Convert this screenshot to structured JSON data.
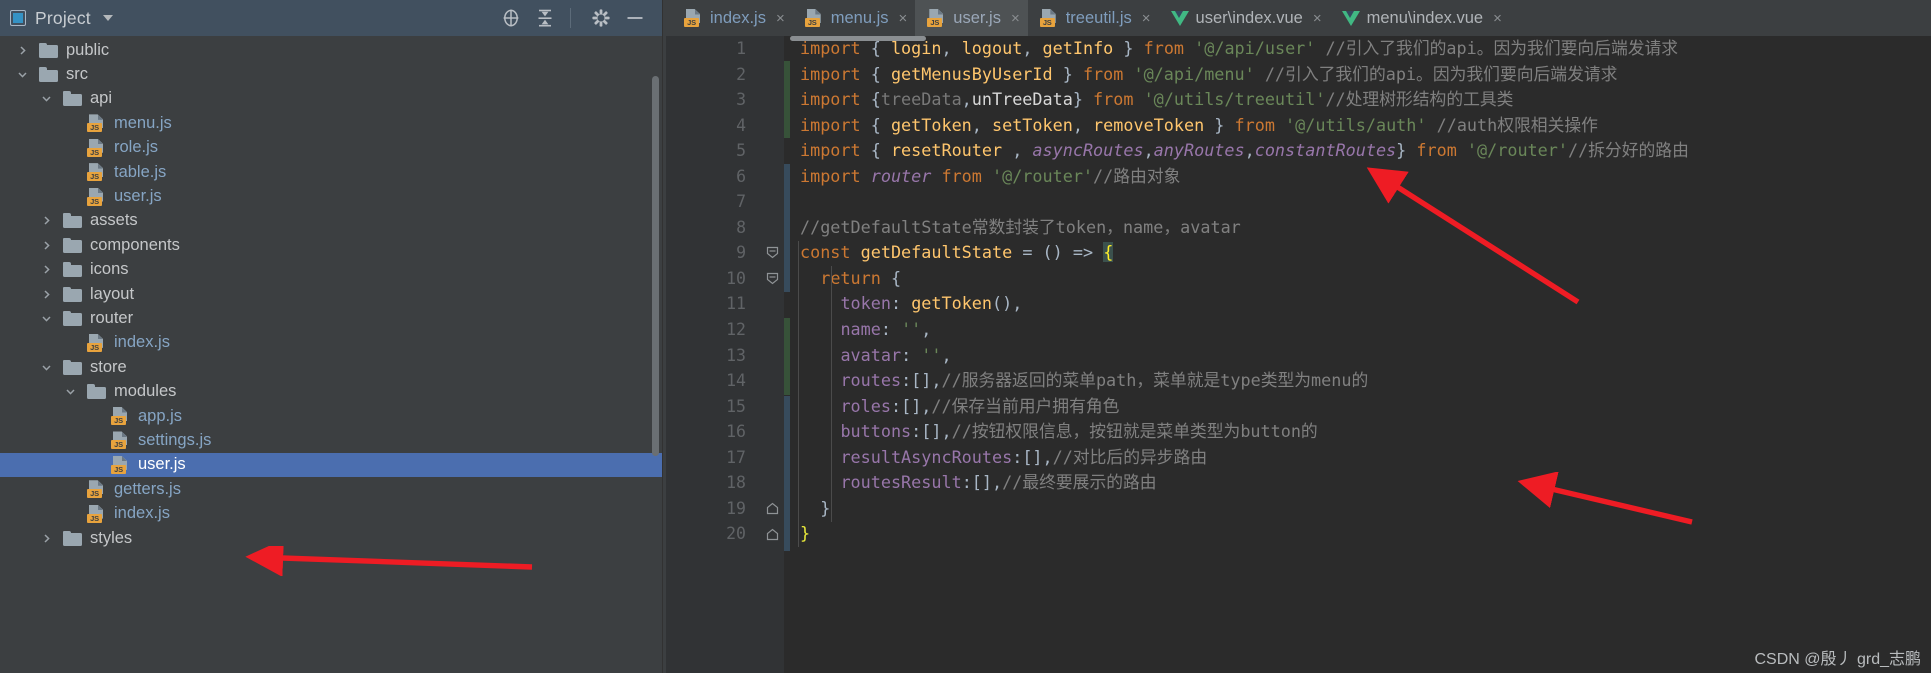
{
  "colors": {
    "panel_bg": "#3c3f41",
    "header_bg": "#41505f",
    "editor_bg": "#2b2b2b",
    "gutter_bg": "#313335",
    "selection_blue": "#4b6eaf",
    "tab_active_bg": "#4e5254",
    "keyword_orange": "#cc7832",
    "string_green": "#6a8759",
    "comment_grey": "#808080",
    "function_yellow": "#ffc66d",
    "property_purple": "#9876aa",
    "js_badge_orange": "#e8a33d",
    "vue_green": "#41b883",
    "arrow_red": "#ee1c24"
  },
  "project_panel": {
    "title": "Project",
    "title_icon": "project-box-icon",
    "dropdown_icon": "chevron-down-icon",
    "toolbar": [
      {
        "name": "locate-icon",
        "glyph": "locate"
      },
      {
        "name": "collapse-all-icon",
        "glyph": "collapse"
      },
      {
        "name": "settings-gear-icon",
        "glyph": "gear"
      },
      {
        "name": "hide-panel-icon",
        "glyph": "minus"
      }
    ],
    "tree": [
      {
        "label": "public",
        "type": "folder",
        "indent": 1,
        "twisty": "collapsed",
        "selected": false
      },
      {
        "label": "src",
        "type": "folder",
        "indent": 1,
        "twisty": "expanded",
        "selected": false
      },
      {
        "label": "api",
        "type": "folder",
        "indent": 2,
        "twisty": "expanded",
        "selected": false
      },
      {
        "label": "menu.js",
        "type": "js",
        "indent": 3,
        "twisty": "none",
        "selected": false
      },
      {
        "label": "role.js",
        "type": "js",
        "indent": 3,
        "twisty": "none",
        "selected": false
      },
      {
        "label": "table.js",
        "type": "js",
        "indent": 3,
        "twisty": "none",
        "selected": false
      },
      {
        "label": "user.js",
        "type": "js",
        "indent": 3,
        "twisty": "none",
        "selected": false
      },
      {
        "label": "assets",
        "type": "folder",
        "indent": 2,
        "twisty": "collapsed",
        "selected": false
      },
      {
        "label": "components",
        "type": "folder",
        "indent": 2,
        "twisty": "collapsed",
        "selected": false
      },
      {
        "label": "icons",
        "type": "folder",
        "indent": 2,
        "twisty": "collapsed",
        "selected": false
      },
      {
        "label": "layout",
        "type": "folder",
        "indent": 2,
        "twisty": "collapsed",
        "selected": false
      },
      {
        "label": "router",
        "type": "folder",
        "indent": 2,
        "twisty": "expanded",
        "selected": false
      },
      {
        "label": "index.js",
        "type": "js",
        "indent": 3,
        "twisty": "none",
        "selected": false
      },
      {
        "label": "store",
        "type": "folder",
        "indent": 2,
        "twisty": "expanded",
        "selected": false
      },
      {
        "label": "modules",
        "type": "folder",
        "indent": 3,
        "twisty": "expanded",
        "selected": false
      },
      {
        "label": "app.js",
        "type": "js",
        "indent": 4,
        "twisty": "none",
        "selected": false
      },
      {
        "label": "settings.js",
        "type": "js",
        "indent": 4,
        "twisty": "none",
        "selected": false
      },
      {
        "label": "user.js",
        "type": "js",
        "indent": 4,
        "twisty": "none",
        "selected": true
      },
      {
        "label": "getters.js",
        "type": "js",
        "indent": 3,
        "twisty": "none",
        "selected": false
      },
      {
        "label": "index.js",
        "type": "js",
        "indent": 3,
        "twisty": "none",
        "selected": false
      },
      {
        "label": "styles",
        "type": "folder",
        "indent": 2,
        "twisty": "collapsed",
        "selected": false
      }
    ]
  },
  "editor": {
    "tabs": [
      {
        "label": "index.js",
        "icon": "js-file-icon",
        "active": false,
        "close": "×"
      },
      {
        "label": "menu.js",
        "icon": "js-file-icon",
        "active": false,
        "close": "×"
      },
      {
        "label": "user.js",
        "icon": "js-file-icon",
        "active": true,
        "close": "×"
      },
      {
        "label": "treeutil.js",
        "icon": "js-file-icon",
        "active": false,
        "close": "×"
      },
      {
        "label": "user\\index.vue",
        "icon": "vue-file-icon",
        "active": false,
        "close": "×"
      },
      {
        "label": "menu\\index.vue",
        "icon": "vue-file-icon",
        "active": false,
        "close": "×"
      }
    ],
    "line_numbers": [
      "1",
      "2",
      "3",
      "4",
      "5",
      "6",
      "7",
      "8",
      "9",
      "10",
      "11",
      "12",
      "13",
      "14",
      "15",
      "16",
      "17",
      "18",
      "19",
      "20"
    ],
    "code": [
      {
        "n": 1,
        "text": "import { login, logout, getInfo } from '@/api/user' //引入了我们的api。因为我们要向后端发请求"
      },
      {
        "n": 2,
        "text": "import { getMenusByUserId } from '@/api/menu' //引入了我们的api。因为我们要向后端发请求"
      },
      {
        "n": 3,
        "text": "import {treeData,unTreeData} from '@/utils/treeutil'//处理树形结构的工具类"
      },
      {
        "n": 4,
        "text": "import { getToken, setToken, removeToken } from '@/utils/auth' //auth权限相关操作"
      },
      {
        "n": 5,
        "text": "import { resetRouter , asyncRoutes,anyRoutes,constantRoutes} from '@/router'//拆分好的路由"
      },
      {
        "n": 6,
        "text": "import router from '@/router'//路由对象"
      },
      {
        "n": 7,
        "text": ""
      },
      {
        "n": 8,
        "text": "//getDefaultState常数封装了token，name，avatar"
      },
      {
        "n": 9,
        "text": "const getDefaultState = () => {"
      },
      {
        "n": 10,
        "text": "  return {"
      },
      {
        "n": 11,
        "text": "    token: getToken(),"
      },
      {
        "n": 12,
        "text": "    name: '',"
      },
      {
        "n": 13,
        "text": "    avatar: '',"
      },
      {
        "n": 14,
        "text": "    routes:[],//服务器返回的菜单path，菜单就是type类型为menu的"
      },
      {
        "n": 15,
        "text": "    roles:[],//保存当前用户拥有角色"
      },
      {
        "n": 16,
        "text": "    buttons:[],//按钮权限信息，按钮就是菜单类型为button的"
      },
      {
        "n": 17,
        "text": "    resultAsyncRoutes:[],//对比后的异步路由"
      },
      {
        "n": 18,
        "text": "    routesResult:[],//最终要展示的路由"
      },
      {
        "n": 19,
        "text": "  }"
      },
      {
        "n": 20,
        "text": "}"
      }
    ]
  },
  "annotations": {
    "arrows": [
      {
        "name": "arrow-to-import-router",
        "points": "from upper-right to line 6"
      },
      {
        "name": "arrow-to-routes-result",
        "points": "from lower-right to line 18"
      },
      {
        "name": "arrow-to-selected-user-js",
        "points": "from right to sidebar user.js"
      }
    ]
  },
  "watermark": {
    "text": "CSDN @殷丿 grd_志鹏"
  }
}
